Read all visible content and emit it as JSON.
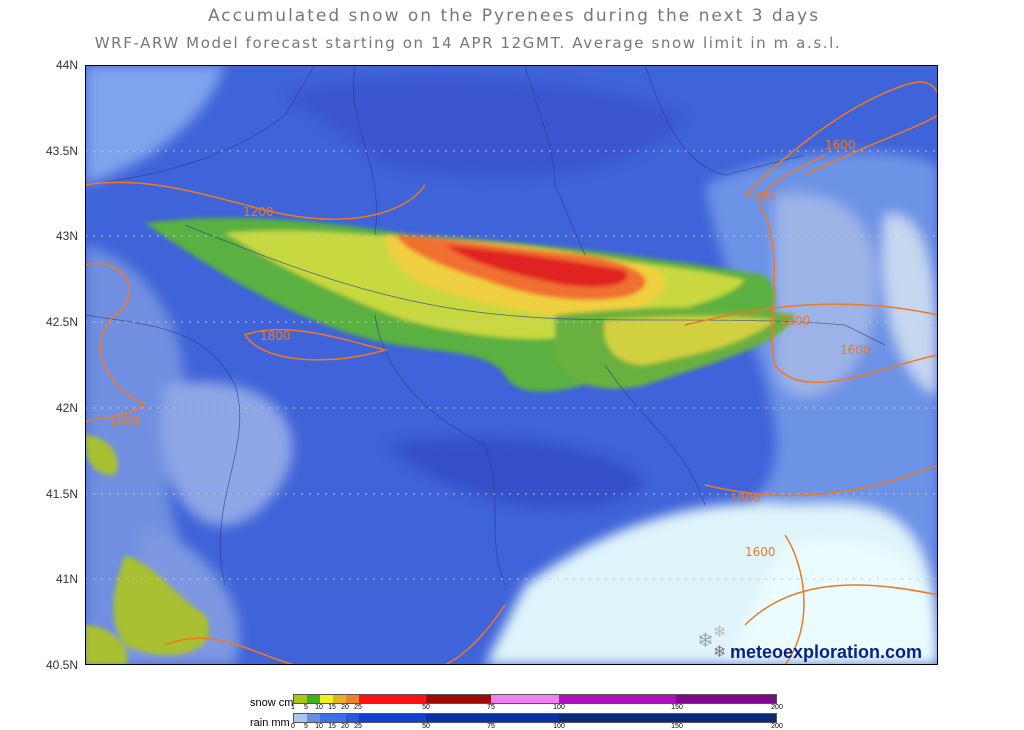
{
  "title": "Accumulated snow on the Pyrenees during the next 3 days",
  "subtitle": "WRF-ARW Model forecast starting on 14 APR 12GMT.  Average snow limit in m a.s.l.",
  "latitude_labels": [
    "44N",
    "43.5N",
    "43N",
    "42.5N",
    "42N",
    "41.5N",
    "41N",
    "40.5N"
  ],
  "contour_labels": [
    "1200",
    "1800",
    "1600",
    "1600",
    "1200",
    "1600",
    "1600",
    "1800",
    "1600"
  ],
  "contour_color": "#f07820",
  "watermark": "meteoexploration.com",
  "legend": {
    "snow": {
      "label": "snow cm",
      "ticks": [
        "1",
        "5",
        "10",
        "15",
        "20",
        "25",
        "50",
        "75",
        "100",
        "150",
        "200"
      ],
      "colors": [
        "#a8c818",
        "#40b020",
        "#f0f020",
        "#e8b020",
        "#f08030",
        "#ff1010",
        "#a00808",
        "#f080f0",
        "#b010c0",
        "#800890"
      ]
    },
    "rain": {
      "label": "rain mm",
      "ticks": [
        "0",
        "5",
        "10",
        "15",
        "20",
        "25",
        "50",
        "75",
        "100",
        "150",
        "200"
      ],
      "colors": [
        "#a8c8f0",
        "#6890e0",
        "#4070e8",
        "#2858e0",
        "#1040d0",
        "#0830a8",
        "#082878"
      ]
    }
  }
}
